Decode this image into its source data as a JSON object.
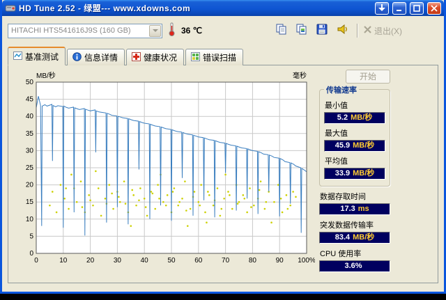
{
  "window": {
    "title": "HD Tune 2.52 - 绿盟--- www.xdowns.com"
  },
  "toolbar": {
    "drive": "HITACHI HTS541616J9S (160 GB)",
    "temperature": "36 ℃",
    "exit_label": "退出(X)"
  },
  "tabs": [
    {
      "label": "基准测试"
    },
    {
      "label": "信息详情"
    },
    {
      "label": "健康状况"
    },
    {
      "label": "错误扫描"
    }
  ],
  "side_panel": {
    "start_button": "开始",
    "transfer_group": {
      "title": "传输速率",
      "items": [
        {
          "label": "最小值",
          "value": "5.2",
          "unit": "MB/秒"
        },
        {
          "label": "最大值",
          "value": "45.9",
          "unit": "MB/秒"
        },
        {
          "label": "平均值",
          "value": "33.9",
          "unit": "MB/秒"
        }
      ]
    },
    "extras": [
      {
        "label": "数据存取时间",
        "value": "17.3",
        "unit": "ms"
      },
      {
        "label": "突发数据传输率",
        "value": "83.4",
        "unit": "MB/秒"
      },
      {
        "label": "CPU 使用率",
        "value": "3.6%",
        "unit": ""
      }
    ]
  },
  "chart_data": {
    "type": "line+scatter",
    "x_axis": {
      "min": 0,
      "max": 100,
      "ticks": [
        0,
        10,
        20,
        30,
        40,
        50,
        60,
        70,
        80,
        90,
        100
      ],
      "last_tick_label": "100%"
    },
    "y_left": {
      "label": "MB/秒",
      "min": 0,
      "max": 50,
      "step": 5
    },
    "y_right": {
      "label": "毫秒"
    },
    "line_color": "#3a7ebf",
    "dot_color": "#cdd103",
    "summary": {
      "min_mbs": 5.2,
      "max_mbs": 45.9,
      "avg_mbs": 33.9,
      "access_time_ms": 17.3,
      "burst_rate_mbs": 83.4,
      "cpu_usage_pct": 3.6
    },
    "transfer_rate_line": [
      [
        0,
        42.5
      ],
      [
        0.8,
        45.9
      ],
      [
        1.6,
        43.2
      ],
      [
        2,
        8
      ],
      [
        2.2,
        43
      ],
      [
        3.2,
        43.4
      ],
      [
        4,
        43
      ],
      [
        5.8,
        43.5
      ],
      [
        6,
        27
      ],
      [
        6.2,
        43.2
      ],
      [
        7.2,
        42.8
      ],
      [
        8,
        43.1
      ],
      [
        9.8,
        42.9
      ],
      [
        10,
        7.5
      ],
      [
        10.2,
        43
      ],
      [
        11.2,
        42.6
      ],
      [
        12,
        42.4
      ],
      [
        13.8,
        42.7
      ],
      [
        14,
        12
      ],
      [
        14.2,
        42.5
      ],
      [
        15.2,
        42.2
      ],
      [
        16,
        42
      ],
      [
        17.8,
        42.3
      ],
      [
        18,
        5.2
      ],
      [
        18.2,
        42.1
      ],
      [
        19.2,
        41.8
      ],
      [
        20,
        41.6
      ],
      [
        21.8,
        41.9
      ],
      [
        22,
        29.5
      ],
      [
        22.2,
        41.6
      ],
      [
        23.2,
        41.3
      ],
      [
        24,
        41.2
      ],
      [
        25.8,
        41
      ],
      [
        26,
        9
      ],
      [
        26.2,
        40.9
      ],
      [
        27.2,
        40.6
      ],
      [
        28,
        40.3
      ],
      [
        29.8,
        40.1
      ],
      [
        30,
        13.5
      ],
      [
        30.2,
        40
      ],
      [
        31.2,
        39.8
      ],
      [
        32,
        39.6
      ],
      [
        33.8,
        39.4
      ],
      [
        34,
        8.5
      ],
      [
        34.2,
        39.3
      ],
      [
        35.2,
        39
      ],
      [
        36,
        38.8
      ],
      [
        37.8,
        38.6
      ],
      [
        38,
        24.5
      ],
      [
        38.2,
        38.5
      ],
      [
        39.2,
        38.2
      ],
      [
        40,
        38
      ],
      [
        41.8,
        37.8
      ],
      [
        42,
        10
      ],
      [
        42.2,
        37.7
      ],
      [
        43.2,
        37.4
      ],
      [
        44,
        37.2
      ],
      [
        45.8,
        37
      ],
      [
        46,
        14
      ],
      [
        46.2,
        36.9
      ],
      [
        47.2,
        36.6
      ],
      [
        48,
        36.4
      ],
      [
        49.8,
        36.2
      ],
      [
        50,
        9.5
      ],
      [
        50.2,
        36.1
      ],
      [
        51.2,
        35.8
      ],
      [
        52,
        35.6
      ],
      [
        53.8,
        35.4
      ],
      [
        54,
        22
      ],
      [
        54.2,
        35.3
      ],
      [
        55.2,
        35
      ],
      [
        56,
        34.8
      ],
      [
        57.8,
        34.6
      ],
      [
        58,
        11
      ],
      [
        58.2,
        34.5
      ],
      [
        59.2,
        34.2
      ],
      [
        60,
        34
      ],
      [
        61.8,
        33.8
      ],
      [
        62,
        15.5
      ],
      [
        62.2,
        33.7
      ],
      [
        63.2,
        33.4
      ],
      [
        64,
        33.2
      ],
      [
        65.8,
        33
      ],
      [
        66,
        10.5
      ],
      [
        66.2,
        32.9
      ],
      [
        67.2,
        32.6
      ],
      [
        68,
        32.4
      ],
      [
        69.8,
        32.2
      ],
      [
        70,
        23.5
      ],
      [
        70.2,
        32.1
      ],
      [
        71.2,
        31.8
      ],
      [
        72,
        31.6
      ],
      [
        73.8,
        31.4
      ],
      [
        74,
        12.5
      ],
      [
        74.2,
        31.3
      ],
      [
        75.2,
        31
      ],
      [
        76,
        30.8
      ],
      [
        77.8,
        30.6
      ],
      [
        78,
        16
      ],
      [
        78.2,
        30.5
      ],
      [
        79.2,
        30.2
      ],
      [
        80,
        30
      ],
      [
        81.8,
        29.8
      ],
      [
        82,
        11.5
      ],
      [
        82.2,
        29.7
      ],
      [
        83.2,
        29.4
      ],
      [
        84,
        29
      ],
      [
        85.8,
        28.8
      ],
      [
        86,
        18
      ],
      [
        86.2,
        28.7
      ],
      [
        87.2,
        28.4
      ],
      [
        88,
        28
      ],
      [
        89.8,
        27.8
      ],
      [
        90,
        10.8
      ],
      [
        90.2,
        27.7
      ],
      [
        91.2,
        27.3
      ],
      [
        92,
        26.8
      ],
      [
        93.8,
        26.5
      ],
      [
        94,
        14.5
      ],
      [
        94.2,
        26.4
      ],
      [
        95.2,
        26
      ],
      [
        96,
        25.5
      ],
      [
        97.8,
        25
      ],
      [
        98,
        6
      ],
      [
        98.2,
        24.8
      ],
      [
        99.2,
        24.3
      ],
      [
        100,
        23.8
      ]
    ],
    "access_time_dots": [
      [
        5,
        14
      ],
      [
        6,
        18
      ],
      [
        7.5,
        12
      ],
      [
        9,
        20
      ],
      [
        10.5,
        16
      ],
      [
        11,
        19
      ],
      [
        12,
        13
      ],
      [
        13,
        23
      ],
      [
        14,
        19
      ],
      [
        15,
        15
      ],
      [
        16.5,
        21
      ],
      [
        17,
        13.5
      ],
      [
        18,
        12
      ],
      [
        19.5,
        17
      ],
      [
        20,
        15.5
      ],
      [
        21,
        14
      ],
      [
        22,
        24
      ],
      [
        23,
        19
      ],
      [
        24,
        11
      ],
      [
        25.5,
        16
      ],
      [
        26,
        14.5
      ],
      [
        27,
        20
      ],
      [
        28,
        17.5
      ],
      [
        28.5,
        13
      ],
      [
        30,
        18
      ],
      [
        30.5,
        16.5
      ],
      [
        31,
        15
      ],
      [
        32.5,
        21
      ],
      [
        33,
        14.5
      ],
      [
        34,
        12
      ],
      [
        35,
        8
      ],
      [
        35.5,
        18.5
      ],
      [
        36,
        17
      ],
      [
        37,
        14
      ],
      [
        38,
        15.5
      ],
      [
        38.5,
        19
      ],
      [
        40,
        16
      ],
      [
        40.5,
        13.5
      ],
      [
        41,
        11
      ],
      [
        42.5,
        18
      ],
      [
        43,
        17.5
      ],
      [
        44,
        13
      ],
      [
        45,
        20
      ],
      [
        45.5,
        16
      ],
      [
        46,
        23
      ],
      [
        47,
        15
      ],
      [
        48,
        14
      ],
      [
        48.5,
        17
      ],
      [
        50,
        12
      ],
      [
        50.5,
        18
      ],
      [
        51,
        19
      ],
      [
        52.5,
        14
      ],
      [
        53,
        15
      ],
      [
        54,
        16
      ],
      [
        55,
        21
      ],
      [
        55.5,
        12.5
      ],
      [
        56,
        8
      ],
      [
        57,
        13
      ],
      [
        58,
        16.5
      ],
      [
        58.5,
        18
      ],
      [
        60,
        15
      ],
      [
        60.5,
        14
      ],
      [
        61,
        20
      ],
      [
        62.5,
        12
      ],
      [
        63,
        9
      ],
      [
        63.5,
        18
      ],
      [
        64,
        17
      ],
      [
        65.5,
        14
      ],
      [
        66,
        15.5
      ],
      [
        67,
        19
      ],
      [
        68,
        11
      ],
      [
        68.5,
        13
      ],
      [
        69.5,
        16
      ],
      [
        70,
        23
      ],
      [
        71,
        18
      ],
      [
        71.5,
        17
      ],
      [
        72.5,
        13
      ],
      [
        74,
        20
      ],
      [
        74.5,
        14.5
      ],
      [
        75,
        15
      ],
      [
        76.5,
        17
      ],
      [
        77,
        16
      ],
      [
        78,
        12
      ],
      [
        79,
        19
      ],
      [
        79.5,
        13.5
      ],
      [
        80.5,
        14
      ],
      [
        82,
        16
      ],
      [
        82.5,
        18.5
      ],
      [
        83,
        21
      ],
      [
        84.5,
        13
      ],
      [
        85,
        15
      ],
      [
        86,
        18
      ],
      [
        87,
        9
      ],
      [
        88,
        15
      ],
      [
        89.5,
        20
      ],
      [
        90.5,
        16
      ],
      [
        91,
        12
      ],
      [
        92.5,
        17
      ],
      [
        93,
        13
      ],
      [
        94,
        14
      ],
      [
        95,
        18
      ],
      [
        96,
        16.5
      ]
    ]
  }
}
